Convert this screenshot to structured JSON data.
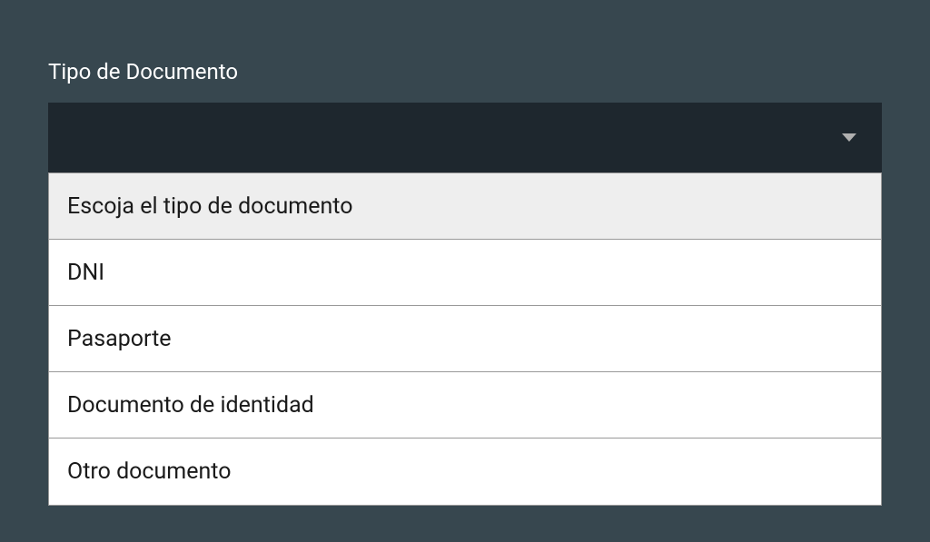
{
  "form": {
    "label": "Tipo de Documento",
    "dropdown": {
      "selected": "",
      "options": [
        {
          "label": "Escoja el tipo de documento",
          "placeholder": true
        },
        {
          "label": "DNI",
          "placeholder": false
        },
        {
          "label": "Pasaporte",
          "placeholder": false
        },
        {
          "label": "Documento de identidad",
          "placeholder": false
        },
        {
          "label": "Otro documento",
          "placeholder": false
        }
      ]
    }
  }
}
